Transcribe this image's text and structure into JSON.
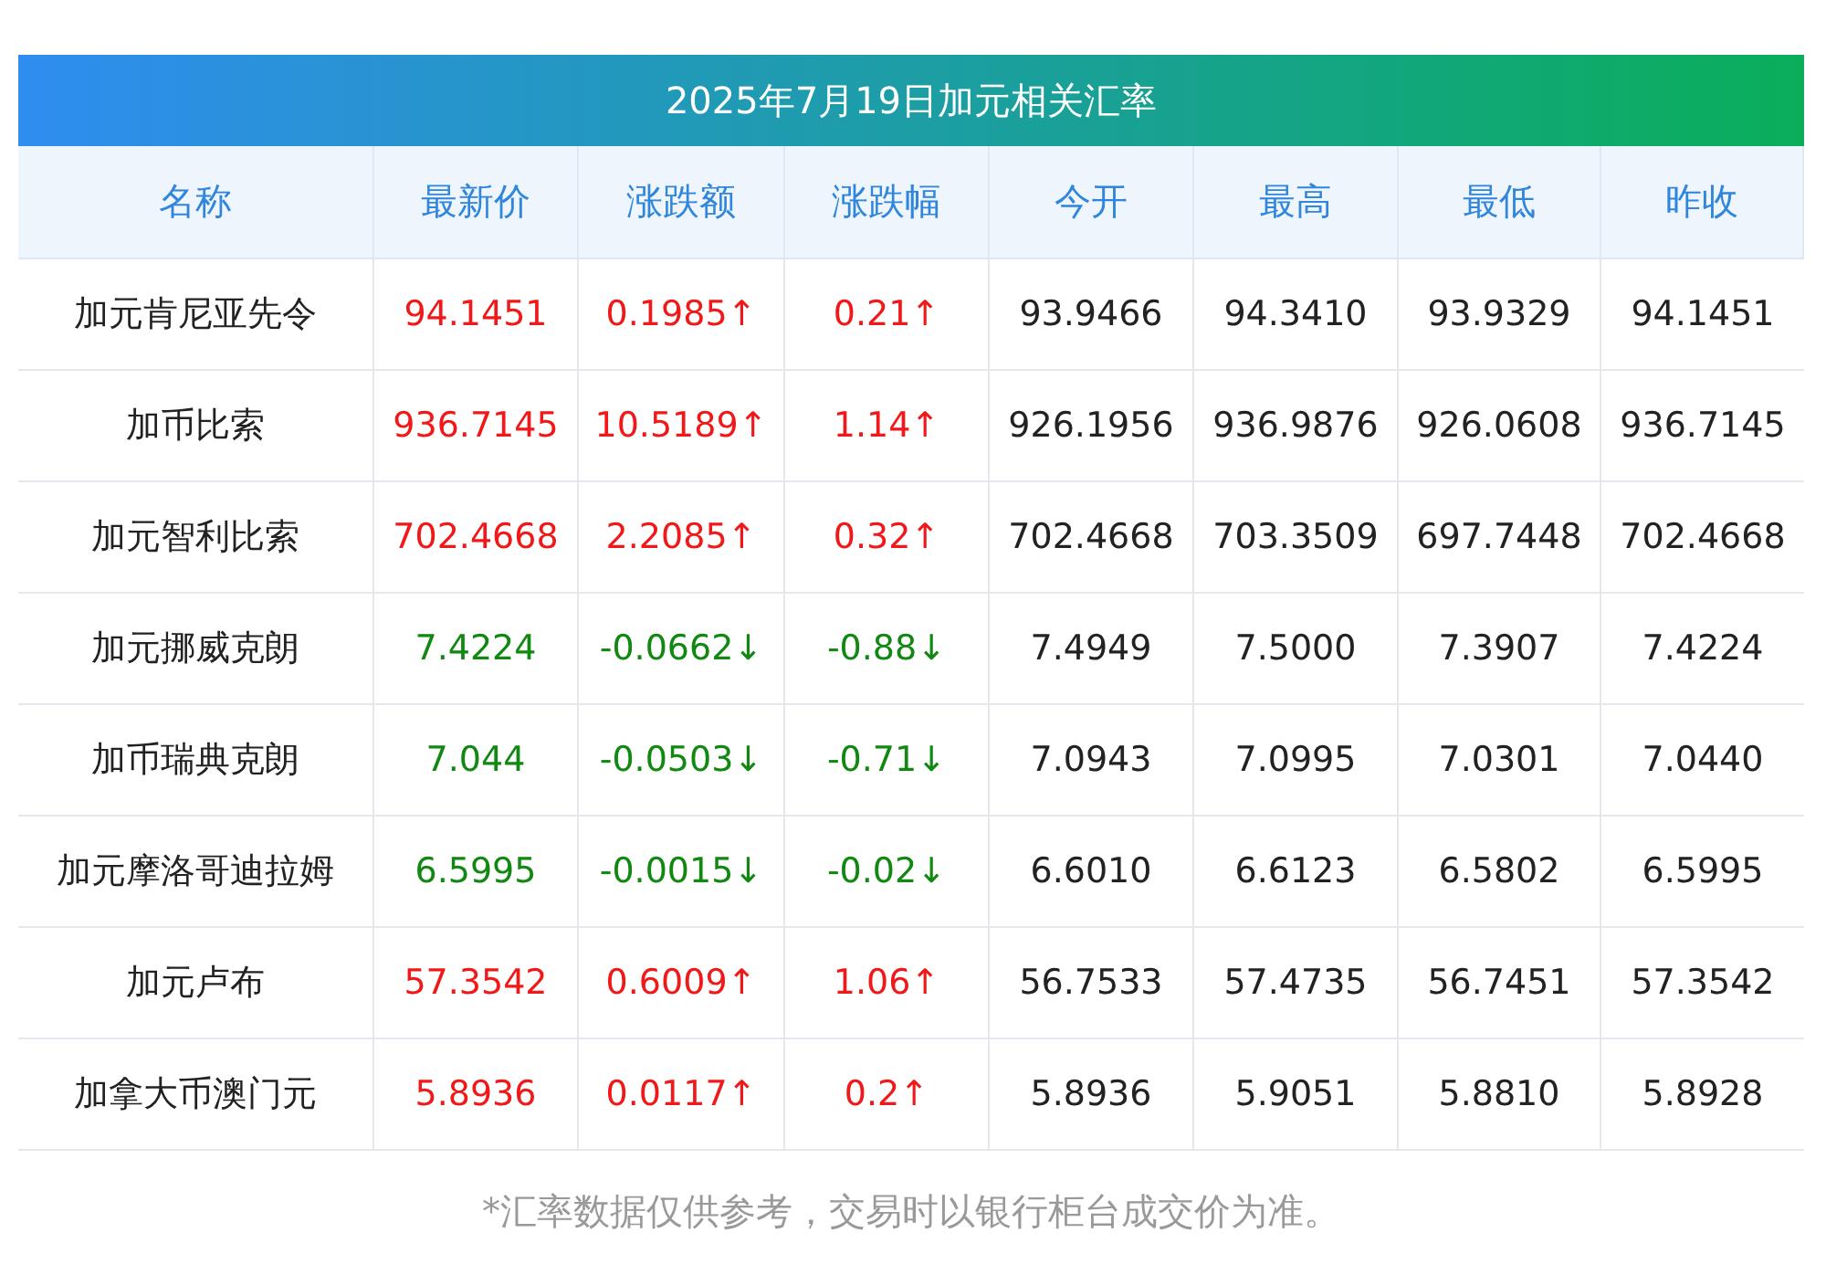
{
  "title": "2025年7月19日加元相关汇率",
  "columns": [
    "名称",
    "最新价",
    "涨跌额",
    "涨跌幅",
    "今开",
    "最高",
    "最低",
    "昨收"
  ],
  "rows": [
    {
      "name": "加元肯尼亚先令",
      "rising": true,
      "latest": "94.1451",
      "change": "0.1985↑",
      "change_pct": "0.21↑",
      "open": "93.9466",
      "high": "94.3410",
      "low": "93.9329",
      "prev_close": "94.1451"
    },
    {
      "name": "加币比索",
      "rising": true,
      "latest": "936.7145",
      "change": "10.5189↑",
      "change_pct": "1.14↑",
      "open": "926.1956",
      "high": "936.9876",
      "low": "926.0608",
      "prev_close": "936.7145"
    },
    {
      "name": "加元智利比索",
      "rising": true,
      "latest": "702.4668",
      "change": "2.2085↑",
      "change_pct": "0.32↑",
      "open": "702.4668",
      "high": "703.3509",
      "low": "697.7448",
      "prev_close": "702.4668"
    },
    {
      "name": "加元挪威克朗",
      "rising": false,
      "latest": "7.4224",
      "change": "-0.0662↓",
      "change_pct": "-0.88↓",
      "open": "7.4949",
      "high": "7.5000",
      "low": "7.3907",
      "prev_close": "7.4224"
    },
    {
      "name": "加币瑞典克朗",
      "rising": false,
      "latest": "7.044",
      "change": "-0.0503↓",
      "change_pct": "-0.71↓",
      "open": "7.0943",
      "high": "7.0995",
      "low": "7.0301",
      "prev_close": "7.0440"
    },
    {
      "name": "加元摩洛哥迪拉姆",
      "rising": false,
      "latest": "6.5995",
      "change": "-0.0015↓",
      "change_pct": "-0.02↓",
      "open": "6.6010",
      "high": "6.6123",
      "low": "6.5802",
      "prev_close": "6.5995"
    },
    {
      "name": "加元卢布",
      "rising": true,
      "latest": "57.3542",
      "change": "0.6009↑",
      "change_pct": "1.06↑",
      "open": "56.7533",
      "high": "57.4735",
      "low": "56.7451",
      "prev_close": "57.3542"
    },
    {
      "name": "加拿大币澳门元",
      "rising": true,
      "latest": "5.8936",
      "change": "0.0117↑",
      "change_pct": "0.2↑",
      "open": "5.8936",
      "high": "5.9051",
      "low": "5.8810",
      "prev_close": "5.8928"
    }
  ],
  "footnote": "*汇率数据仅供参考，交易时以银行柜台成交价为准。"
}
